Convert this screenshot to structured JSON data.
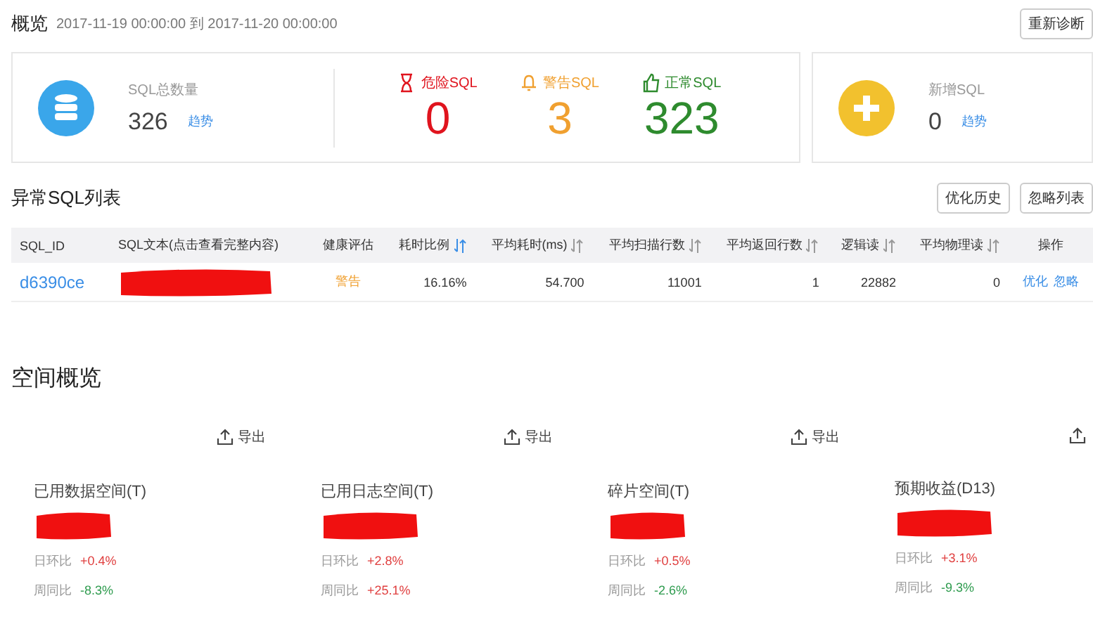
{
  "overview": {
    "title": "概览",
    "range": "2017-11-19 00:00:00 到 2017-11-20 00:00:00",
    "button": "重新诊断"
  },
  "summary": {
    "total": {
      "label": "SQL总数量",
      "value": "326",
      "link": "趋势"
    },
    "levels": [
      {
        "kind": "danger",
        "label": "危险SQL",
        "value": "0"
      },
      {
        "kind": "warning",
        "label": "警告SQL",
        "value": "3"
      },
      {
        "kind": "normal",
        "label": "正常SQL",
        "value": "323"
      }
    ],
    "new": {
      "label": "新增SQL",
      "value": "0",
      "link": "趋势"
    }
  },
  "abnormal": {
    "title": "异常SQL列表",
    "buttons": [
      "优化历史",
      "忽略列表"
    ],
    "columns": [
      {
        "label": "SQL_ID",
        "sortable": false
      },
      {
        "label": "SQL文本(点击查看完整内容)",
        "sortable": false
      },
      {
        "label": "健康评估",
        "sortable": false
      },
      {
        "label": "耗时比例",
        "sortable": true,
        "sorted": true
      },
      {
        "label": "平均耗时(ms)",
        "sortable": true,
        "sorted": false
      },
      {
        "label": "平均扫描行数",
        "sortable": true,
        "sorted": false
      },
      {
        "label": "平均返回行数",
        "sortable": true,
        "sorted": false
      },
      {
        "label": "逻辑读",
        "sortable": true,
        "sorted": false
      },
      {
        "label": "平均物理读",
        "sortable": true,
        "sorted": false
      },
      {
        "label": "操作",
        "sortable": false
      }
    ],
    "rows": [
      {
        "sql_id": "d6390ce",
        "sql_text_redacted": true,
        "health": "警告",
        "ratio": "16.16%",
        "avg_time": "54.700",
        "avg_scan": "11001",
        "avg_return": "1",
        "logical": "22882",
        "physical": "0",
        "actions": [
          "优化",
          "忽略"
        ]
      }
    ]
  },
  "space": {
    "title": "空间概览",
    "exports": [
      "导出",
      "导出",
      "导出"
    ],
    "cards": [
      {
        "label": "已用数据空间(T)",
        "redacted": true,
        "stats": [
          {
            "label": "日环比",
            "value": "+0.4%",
            "color": "#e04040"
          },
          {
            "label": "周同比",
            "value": "-8.3%",
            "color": "#2e9b4e"
          }
        ]
      },
      {
        "label": "已用日志空间(T)",
        "redacted": true,
        "stats": [
          {
            "label": "日环比",
            "value": "+2.8%",
            "color": "#e04040"
          },
          {
            "label": "周同比",
            "value": "+25.1%",
            "color": "#e04040"
          }
        ]
      },
      {
        "label": "碎片空间(T)",
        "redacted": true,
        "stats": [
          {
            "label": "日环比",
            "value": "+0.5%",
            "color": "#e04040"
          },
          {
            "label": "周同比",
            "value": "-2.6%",
            "color": "#2e9b4e"
          }
        ]
      },
      {
        "label": "预期收益(D13)",
        "redacted": true,
        "stats": [
          {
            "label": "日环比",
            "value": "+3.1%",
            "color": "#e04040"
          },
          {
            "label": "周同比",
            "value": "-9.3%",
            "color": "#2e9b4e"
          }
        ]
      }
    ]
  }
}
